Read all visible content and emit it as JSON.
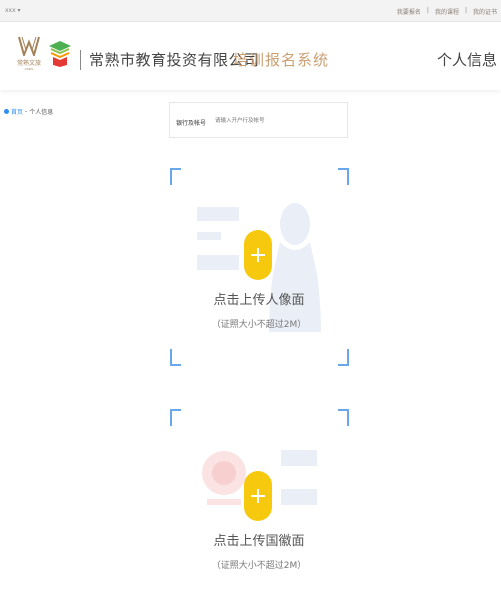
{
  "topbar": {
    "user": "xxx ▾",
    "links": [
      "我要报名",
      "我的课程",
      "我的证书"
    ]
  },
  "header": {
    "logo_text": "常熟文旅",
    "logo_subtext": "CSWL",
    "company": "常熟市教育投资有限公司",
    "system_name": "培训报名系统",
    "user_info": "个人信息"
  },
  "breadcrumb": {
    "home": "首页",
    "separator": " - ",
    "current": "个人信息"
  },
  "bank": {
    "label": "银行及帐号",
    "placeholder": "请输入开户行及帐号"
  },
  "upload_portrait": {
    "title": "点击上传人像面",
    "hint": "（证照大小不超过2M）"
  },
  "upload_emblem": {
    "title": "点击上传国徽面",
    "hint": "（证照大小不超过2M）"
  },
  "colors": {
    "accent_gold": "#caa072",
    "link_blue": "#2a8ff0",
    "plus_yellow": "#f6c90e",
    "corner_blue": "#6aa6ea"
  }
}
